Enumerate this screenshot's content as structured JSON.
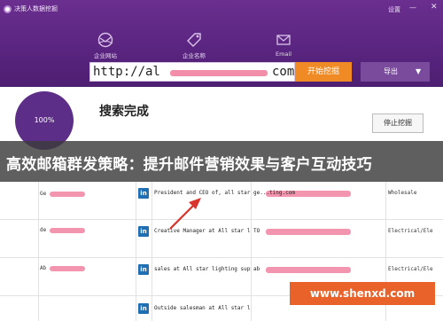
{
  "window": {
    "app_title": "决策人数据挖掘",
    "settings_label": "设置",
    "minimize_glyph": "—",
    "close_glyph": "✕"
  },
  "modes": [
    {
      "label": "企业网站",
      "icon": "globe-mail-icon"
    },
    {
      "label": "企业名称",
      "icon": "tag-icon"
    },
    {
      "label": "Email",
      "icon": "envelope-icon"
    }
  ],
  "url_bar": {
    "text_start": "http://al",
    "text_end": "com"
  },
  "buttons": {
    "start": "开始挖掘",
    "export": "导出",
    "stop": "停止挖掘"
  },
  "progress": {
    "text": "100%",
    "value": 1.0
  },
  "status_heading": "搜索完成",
  "banner_title": "高效邮箱群发策略：提升邮件营销效果与客户互动技巧",
  "table": {
    "rows": [
      {
        "name": "Ge",
        "title": "President and CEO of, all star light",
        "email": "ge...ting.com",
        "industry": "Wholesale"
      },
      {
        "name": "de",
        "title": "Creative Manager at All star lightin",
        "email": "TO",
        "industry": "Electrical/Ele"
      },
      {
        "name": "Ab",
        "title": "sales at All star lighting supplies",
        "email": "ab",
        "industry": "Electrical/Ele"
      },
      {
        "name": "",
        "title": "Outside salesman at All star lightin",
        "email": "",
        "industry": ""
      }
    ],
    "linkedin_glyph": "in"
  },
  "watermark": "www.shenxd.com",
  "colors": {
    "header_purple": "#5a2580",
    "start_orange": "#f08a24",
    "export_purple": "#7a4a9d",
    "linkedin_blue": "#1f6fb2",
    "watermark_orange": "#e8622a"
  }
}
